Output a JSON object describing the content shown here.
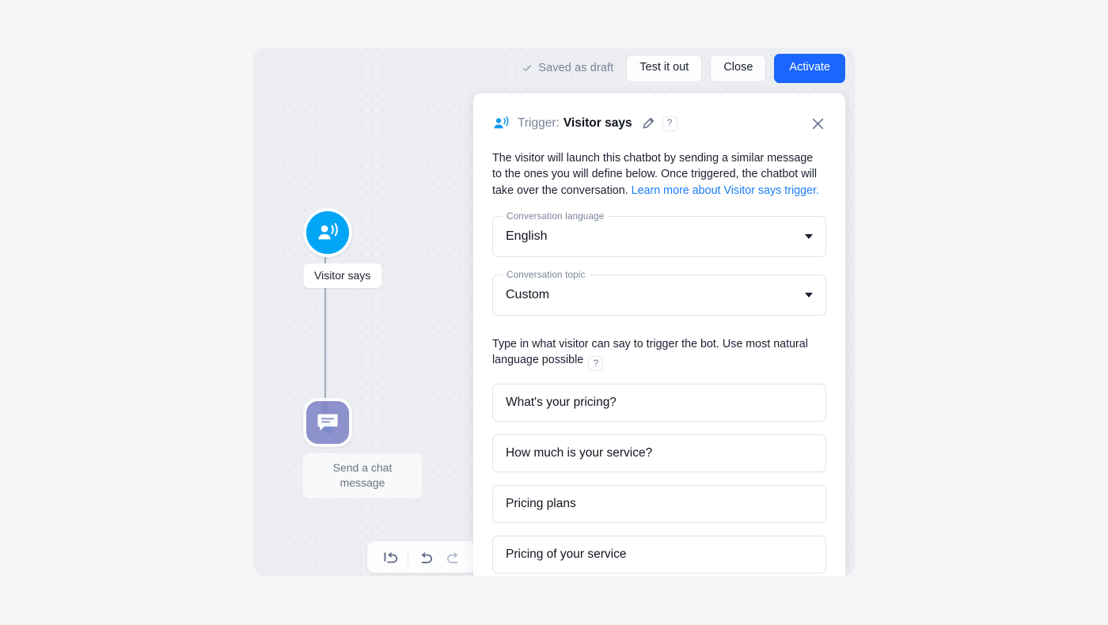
{
  "toolbar": {
    "saved_status": "Saved as draft",
    "test_label": "Test it out",
    "close_label": "Close",
    "activate_label": "Activate"
  },
  "canvas": {
    "nodes": [
      {
        "label": "Visitor says",
        "icon": "visitor-says-icon",
        "color": "#00a6f5"
      },
      {
        "label": "Send a chat message",
        "icon": "chat-message-icon",
        "color": "#8085c7"
      }
    ],
    "tools": [
      {
        "name": "reset-icon"
      },
      {
        "name": "undo-icon"
      },
      {
        "name": "redo-icon"
      }
    ]
  },
  "panel": {
    "trigger_prefix": "Trigger:",
    "trigger_name": "Visitor says",
    "help_glyph": "?",
    "description_text": "The visitor will launch this chatbot by sending a similar message to the ones you will define below. Once triggered, the chatbot will take over the conversation. ",
    "description_link": "Learn more about Visitor says trigger.",
    "fields": [
      {
        "label": "Conversation language",
        "value": "English"
      },
      {
        "label": "Conversation topic",
        "value": "Custom"
      }
    ],
    "hint_text": "Type in what visitor can say to trigger the bot. Use most natural language possible",
    "phrases": [
      "What's your pricing?",
      "How much is your service?",
      "Pricing plans",
      "Pricing of your service"
    ]
  },
  "colors": {
    "accent_blue": "#1a66ff",
    "trigger_blue": "#00a6f5",
    "node_purple": "#8085c7",
    "link_blue": "#1a7df5"
  }
}
